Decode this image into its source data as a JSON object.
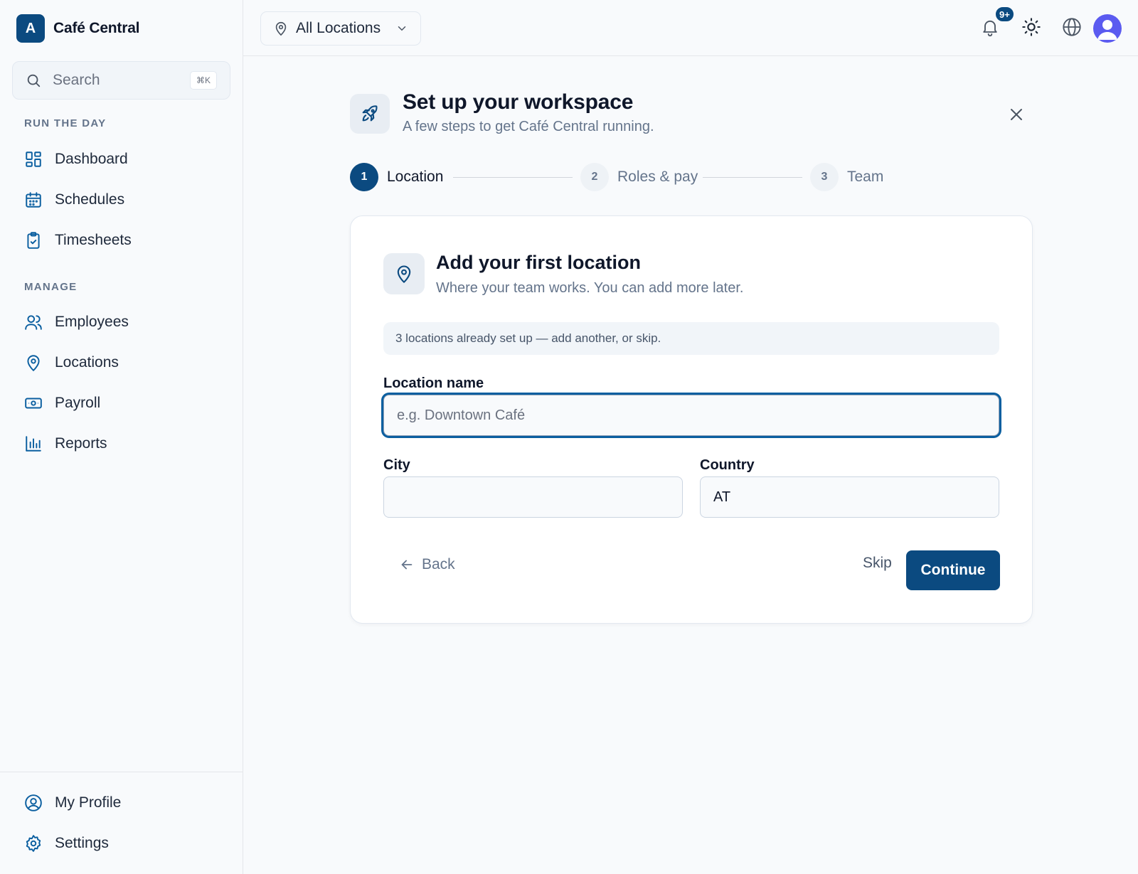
{
  "app": {
    "logo_letter": "A",
    "name": "Café Central"
  },
  "search": {
    "placeholder": "Search",
    "shortcut": "⌘K"
  },
  "sidebar": {
    "sections": [
      {
        "label": "RUN THE DAY"
      },
      {
        "label": "MANAGE"
      }
    ],
    "items": [
      {
        "label": "Dashboard",
        "icon": "dashboard-icon"
      },
      {
        "label": "Schedules",
        "icon": "calendar-icon"
      },
      {
        "label": "Timesheets",
        "icon": "clipboard-check-icon"
      },
      {
        "label": "Employees",
        "icon": "users-icon"
      },
      {
        "label": "Locations",
        "icon": "map-pin-icon"
      },
      {
        "label": "Payroll",
        "icon": "banknote-icon"
      },
      {
        "label": "Reports",
        "icon": "bar-chart-icon"
      }
    ],
    "footer": [
      {
        "label": "My Profile",
        "icon": "user-circle-icon"
      },
      {
        "label": "Settings",
        "icon": "gear-icon"
      }
    ]
  },
  "topbar": {
    "location_select": "All Locations",
    "notification_badge": "9+"
  },
  "wizard": {
    "title": "Set up your workspace",
    "subtitle": "A few steps to get Café Central running.",
    "steps": [
      {
        "num": "1",
        "label": "Location",
        "active": true
      },
      {
        "num": "2",
        "label": "Roles & pay",
        "active": false
      },
      {
        "num": "3",
        "label": "Team",
        "active": false
      }
    ]
  },
  "card": {
    "title": "Add your first location",
    "subtitle": "Where your team works. You can add more later.",
    "notice": "3 locations already set up — add another, or skip.",
    "fields": {
      "location_name": {
        "label": "Location name",
        "placeholder": "e.g. Downtown Café",
        "value": ""
      },
      "city": {
        "label": "City",
        "value": ""
      },
      "country": {
        "label": "Country",
        "value": "AT"
      }
    },
    "actions": {
      "back": "Back",
      "skip": "Skip",
      "continue": "Continue"
    }
  },
  "colors": {
    "brand": "#0b4a80",
    "focus_ring": "#0b5fa0",
    "icon_accent": "#0b5fa0"
  }
}
